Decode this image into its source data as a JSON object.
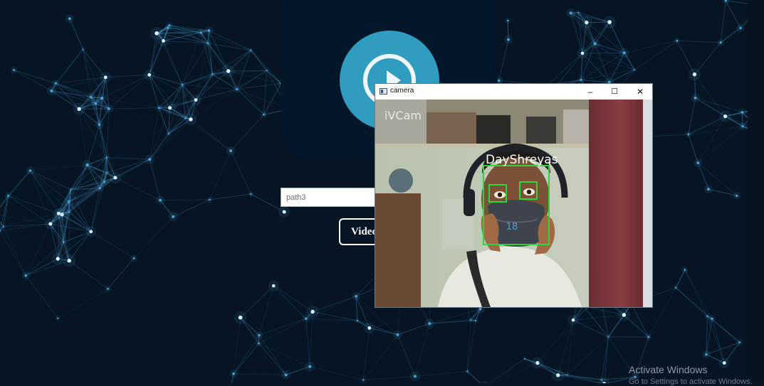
{
  "background": {
    "color": "#061423",
    "node_color": "#4a9fd0"
  },
  "player_card": {
    "icon": "play-circle-icon",
    "accent": "#2f9cc0"
  },
  "path_input": {
    "value": "",
    "placeholder": "path3"
  },
  "video_button": {
    "label": "Video"
  },
  "camera_window": {
    "title": "camera",
    "controls": {
      "minimize": "–",
      "maximize": "☐",
      "close": "✕"
    },
    "overlay": {
      "watermark": "iVCam",
      "face_label": "DayShreyas",
      "mask_text": "18",
      "box_color": "#2fd33a"
    }
  },
  "windows_activation": {
    "title": "Activate Windows",
    "subtitle": "Go to Settings to activate Windows."
  }
}
